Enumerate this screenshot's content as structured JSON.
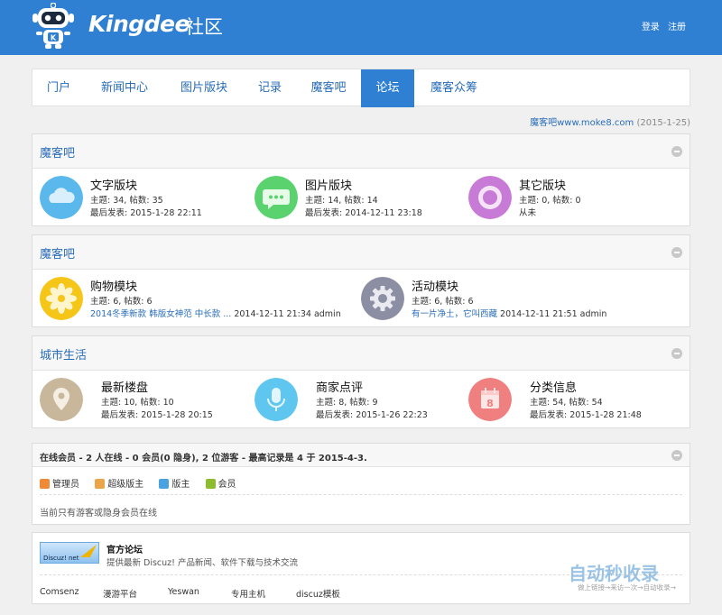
{
  "header": {
    "brand": "Kingdee",
    "brand_sub": "社区",
    "login": "登录",
    "register": "注册",
    "colors": {
      "bar": "#2f7fd3"
    }
  },
  "nav": {
    "items": [
      "门户",
      "新闻中心",
      "图片版块",
      "记录",
      "魔客吧",
      "论坛",
      "魔客众筹"
    ],
    "active": "论坛"
  },
  "info": {
    "site": "魔客吧www.moke8.com",
    "date": "(2015-1-25)"
  },
  "sections": [
    {
      "title": "魔客吧",
      "forums": [
        {
          "name": "文字版块",
          "stats": "主题: 34, 帖数: 35",
          "last": "最后发表: 2015-1-28 22:11",
          "icon": "cloud-icon",
          "color": "#5bb8ec"
        },
        {
          "name": "图片版块",
          "stats": "主题: 14, 帖数: 14",
          "last": "最后发表: 2014-12-11 23:18",
          "icon": "chat-bubble-icon",
          "color": "#5ad36f"
        },
        {
          "name": "其它版块",
          "stats": "主题: 0, 帖数: 0",
          "last": "从未",
          "icon": "ring-icon",
          "color": "#c77bd6"
        }
      ]
    },
    {
      "title": "魔客吧",
      "forums": [
        {
          "name": "购物模块",
          "stats": "主题: 6, 帖数: 6",
          "last_link": "2014冬季新款 韩版女神范 中长款 ...",
          "last_time": " 2014-12-11 21:34 admin",
          "icon": "flower-icon",
          "color": "#f5c518"
        },
        {
          "name": "活动模块",
          "stats": "主题: 6, 帖数: 6",
          "last_link": "有一片净土，它叫西藏",
          "last_time": " 2014-12-11 21:51 admin",
          "icon": "gear-icon",
          "color": "#8c8ea3"
        }
      ]
    },
    {
      "title": "城市生活",
      "forums": [
        {
          "name": "最新楼盘",
          "stats": "主题: 10, 帖数: 10",
          "last": "最后发表: 2015-1-28 20:15",
          "icon": "location-pin-icon",
          "color": "#c9b79b"
        },
        {
          "name": "商家点评",
          "stats": "主题: 8, 帖数: 9",
          "last": "最后发表: 2015-1-26 22:23",
          "icon": "microphone-icon",
          "color": "#5fc7ef"
        },
        {
          "name": "分类信息",
          "stats": "主题: 54, 帖数: 54",
          "last": "最后发表: 2015-1-28 21:48",
          "icon": "calendar-icon",
          "color": "#f07f7f"
        }
      ]
    }
  ],
  "online": {
    "title": "在线会员 - 2 人在线 - 0 会员(0 隐身), 2 位游客 - 最高记录是 4 于 2015-4-3.",
    "legend": [
      {
        "label": "管理员",
        "color": "#f08a36"
      },
      {
        "label": "超级版主",
        "color": "#e8a54a"
      },
      {
        "label": "版主",
        "color": "#4aa3e0"
      },
      {
        "label": "会员",
        "color": "#8dbd2e"
      }
    ],
    "note": "当前只有游客或隐身会员在线"
  },
  "official": {
    "logo_text": "Discuz! net",
    "title": "官方论坛",
    "desc": "提供最新 Discuz! 产品新闻、软件下载与技术交流",
    "links": [
      "Comsenz",
      "漫游平台",
      "Yeswan",
      "专用主机",
      "discuz模板"
    ]
  },
  "watermark": {
    "main": "自动秒收录",
    "sub": "做上链接→来访一次→自动收录→"
  }
}
